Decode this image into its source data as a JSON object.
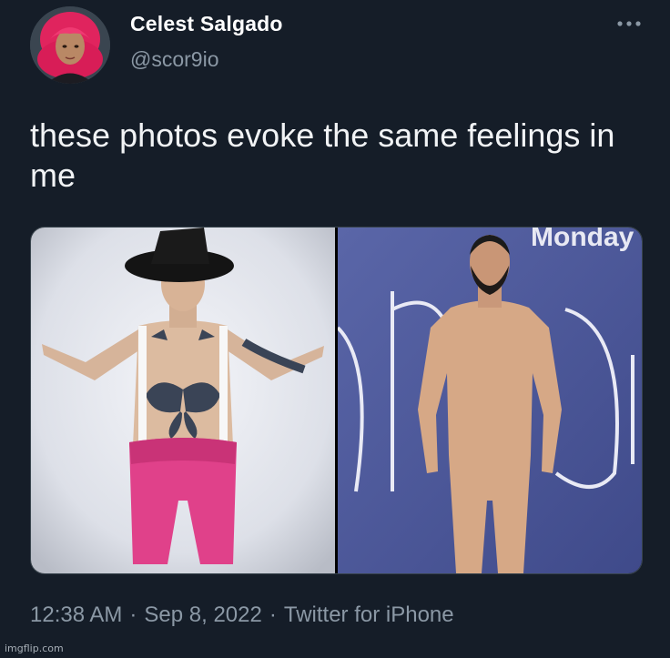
{
  "author": {
    "display_name": "Celest Salgado",
    "handle": "@scor9io",
    "avatar_icon": "profile-photo-red-hair"
  },
  "more_icon": "more-horizontal-icon",
  "tweet": {
    "text": "these photos evoke the same feelings in me"
  },
  "media": {
    "photos": [
      {
        "icon": "photo-man-witch-hat-pink-tights"
      },
      {
        "icon": "photo-man-nude-suit-blue-backdrop"
      }
    ],
    "right_backdrop_text": "Monday"
  },
  "meta": {
    "time": "12:38 AM",
    "separator": "·",
    "date": "Sep 8, 2022",
    "source": "Twitter for iPhone"
  },
  "watermark": "imgflip.com",
  "colors": {
    "background": "#151d28",
    "primary_text": "#ffffff",
    "secondary_text": "#8b98a5",
    "border": "#38444d"
  }
}
